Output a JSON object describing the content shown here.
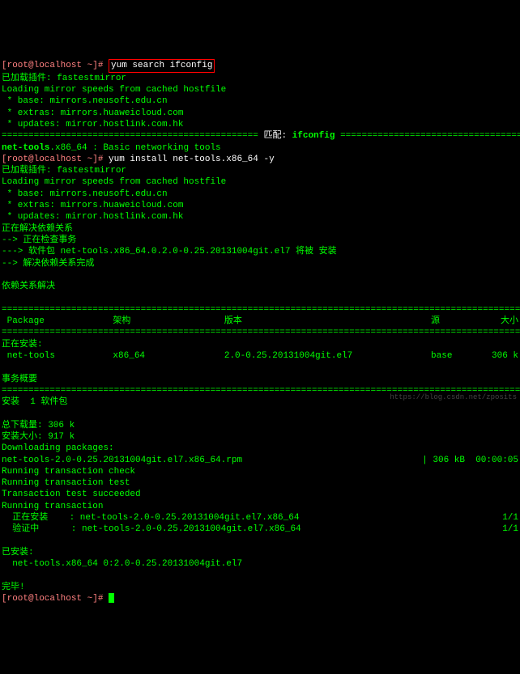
{
  "prompt1": "[root@localhost ~]# ",
  "cmd1": "yum search ifconfig",
  "line_plugin": "已加载插件: fastestmirror",
  "line_loading": "Loading mirror speeds from cached hostfile",
  "line_base": " * base: mirrors.neusoft.edu.cn",
  "line_extras": " * extras: mirrors.huaweicloud.com",
  "line_updates": " * updates: mirror.hostlink.com.hk",
  "match_sep_left": "================================================ ",
  "match_label": "匹配: ",
  "match_term": "ifconfig",
  "match_sep_right": " ================================================",
  "search_result_pkg": "net-tools",
  "search_result_rest": ".x86_64 : Basic networking tools",
  "prompt2": "[root@localhost ~]# ",
  "cmd2": "yum install net-tools.x86_64 -y",
  "resolve1": "正在解决依赖关系",
  "resolve2": "--> 正在检查事务",
  "resolve3": "---> 软件包 net-tools.x86_64.0.2.0-0.25.20131004git.el7 将被 安装",
  "resolve4": "--> 解决依赖关系完成",
  "dep_header": "依赖关系解决",
  "sep_eq": "=======================================================================================================",
  "sep_eq2": "=======================================================================================================",
  "hdr_pkg": " Package",
  "hdr_arch": "架构",
  "hdr_ver": "版本",
  "hdr_repo": "源",
  "hdr_size": "大小",
  "install_header": "正在安装:",
  "pkg_name": " net-tools",
  "pkg_arch": "x86_64",
  "pkg_ver": "2.0-0.25.20131004git.el7",
  "pkg_repo": "base",
  "pkg_size": "306 k",
  "summary_header": "事务概要",
  "summary_install": "安装  1 软件包",
  "total_dl": "总下载量: 306 k",
  "install_size": "安装大小: 917 k",
  "dl_packages": "Downloading packages:",
  "rpm_line": "net-tools-2.0-0.25.20131004git.el7.x86_64.rpm",
  "rpm_size": " | 306 kB  00:00:05",
  "run_check": "Running transaction check",
  "run_test": "Running transaction test",
  "test_ok": "Transaction test succeeded",
  "run_trans": "Running transaction",
  "installing_line": "  正在安装    : net-tools-2.0-0.25.20131004git.el7.x86_64",
  "progress1": "1/1",
  "verifying_line": "  验证中      : net-tools-2.0-0.25.20131004git.el7.x86_64",
  "progress2": "1/1",
  "installed_header": "已安装:",
  "installed_pkg": "  net-tools.x86_64 0:2.0-0.25.20131004git.el7",
  "complete": "完毕!",
  "prompt3": "[root@localhost ~]# ",
  "watermark": "https://blog.csdn.net/zposits"
}
